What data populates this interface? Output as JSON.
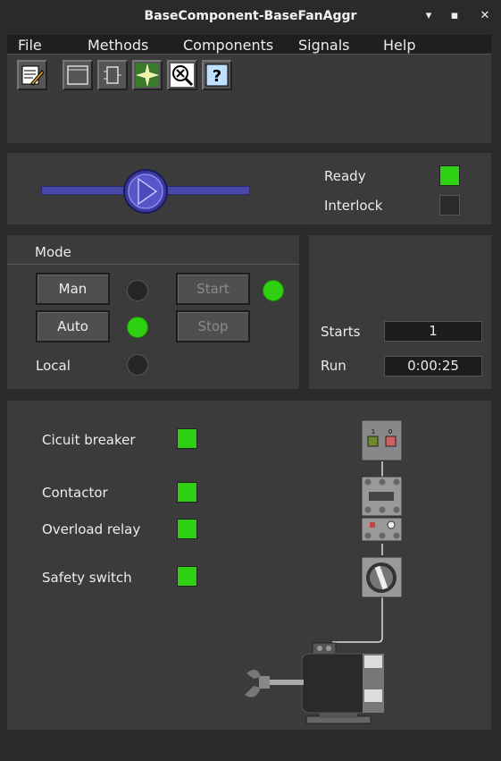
{
  "window": {
    "title": "BaseComponent-BaseFanAggr",
    "min": "▾",
    "max": "▪",
    "close": "✕"
  },
  "menu": [
    "File",
    "Methods",
    "Components",
    "Signals",
    "Help"
  ],
  "toolbar": [
    {
      "icon": "notepad-edit-icon"
    },
    {
      "icon": "window-icon"
    },
    {
      "icon": "component-icon"
    },
    {
      "icon": "flash-star-icon"
    },
    {
      "icon": "search-x-icon"
    },
    {
      "icon": "help-icon",
      "label": "?"
    }
  ],
  "status": {
    "ready_label": "Ready",
    "interlock_label": "Interlock",
    "ready": true,
    "interlock": false
  },
  "fan": {
    "speed_fraction": 0.5
  },
  "mode": {
    "title": "Mode",
    "man_label": "Man",
    "auto_label": "Auto",
    "local_label": "Local",
    "start_label": "Start",
    "stop_label": "Stop",
    "man_active": false,
    "auto_active": true,
    "local_active": false,
    "start_active": true
  },
  "counters": {
    "starts_label": "Starts",
    "starts_value": "1",
    "run_label": "Run",
    "run_value": "0:00:25"
  },
  "signals": [
    {
      "label": "Cicuit breaker",
      "on": true
    },
    {
      "label": "Contactor",
      "on": true
    },
    {
      "label": "Overload relay",
      "on": true
    },
    {
      "label": "Safety switch",
      "on": true
    }
  ],
  "breaker": {
    "on_label": "1",
    "off_label": "0"
  },
  "colors": {
    "green": "#2fd012",
    "panel": "#3b3b3b",
    "accent": "#4848a8"
  }
}
